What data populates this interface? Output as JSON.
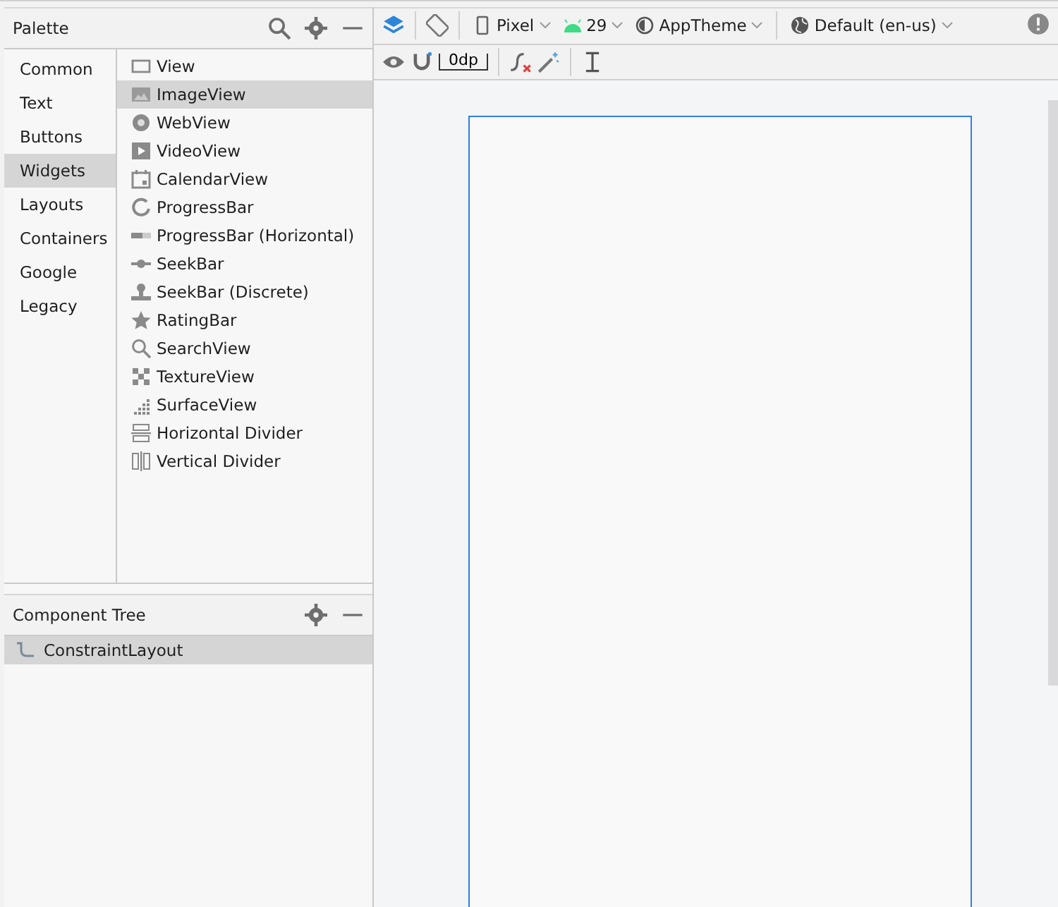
{
  "palette": {
    "title": "Palette",
    "categories": [
      {
        "label": "Common",
        "selected": false
      },
      {
        "label": "Text",
        "selected": false
      },
      {
        "label": "Buttons",
        "selected": false
      },
      {
        "label": "Widgets",
        "selected": true
      },
      {
        "label": "Layouts",
        "selected": false
      },
      {
        "label": "Containers",
        "selected": false
      },
      {
        "label": "Google",
        "selected": false
      },
      {
        "label": "Legacy",
        "selected": false
      }
    ],
    "widgets": [
      {
        "label": "View",
        "selected": false
      },
      {
        "label": "ImageView",
        "selected": true
      },
      {
        "label": "WebView",
        "selected": false
      },
      {
        "label": "VideoView",
        "selected": false
      },
      {
        "label": "CalendarView",
        "selected": false
      },
      {
        "label": "ProgressBar",
        "selected": false
      },
      {
        "label": "ProgressBar (Horizontal)",
        "selected": false
      },
      {
        "label": "SeekBar",
        "selected": false
      },
      {
        "label": "SeekBar (Discrete)",
        "selected": false
      },
      {
        "label": "RatingBar",
        "selected": false
      },
      {
        "label": "SearchView",
        "selected": false
      },
      {
        "label": "TextureView",
        "selected": false
      },
      {
        "label": "SurfaceView",
        "selected": false
      },
      {
        "label": "Horizontal Divider",
        "selected": false
      },
      {
        "label": "Vertical Divider",
        "selected": false
      }
    ]
  },
  "component_tree": {
    "title": "Component Tree",
    "items": [
      {
        "label": "ConstraintLayout",
        "selected": true
      }
    ]
  },
  "toolbar": {
    "device": "Pixel",
    "api": "29",
    "theme": "AppTheme",
    "locale": "Default (en-us)",
    "margin": "0dp"
  }
}
